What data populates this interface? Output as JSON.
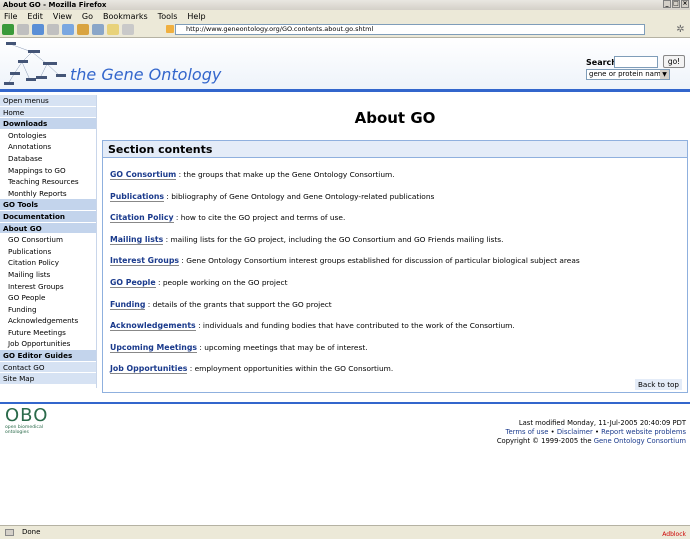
{
  "window": {
    "title": "About GO - Mozilla Firefox"
  },
  "menu": [
    "File",
    "Edit",
    "View",
    "Go",
    "Bookmarks",
    "Tools",
    "Help"
  ],
  "address": {
    "url": "http://www.geneontology.org/GO.contents.about.go.shtml"
  },
  "header": {
    "site_title": "the Gene Ontology",
    "search_label": "Search",
    "search_button": "go!",
    "search_scope": "gene or protein name"
  },
  "sidebar": [
    {
      "label": "Open menus",
      "kind": "top"
    },
    {
      "label": "Home",
      "kind": "top"
    },
    {
      "label": "Downloads",
      "kind": "bold"
    },
    {
      "label": "Ontologies",
      "kind": "sub"
    },
    {
      "label": "Annotations",
      "kind": "sub"
    },
    {
      "label": "Database",
      "kind": "sub"
    },
    {
      "label": "Mappings to GO",
      "kind": "sub"
    },
    {
      "label": "Teaching Resources",
      "kind": "sub"
    },
    {
      "label": "Monthly Reports",
      "kind": "sub"
    },
    {
      "label": "GO Tools",
      "kind": "bold"
    },
    {
      "label": "Documentation",
      "kind": "bold"
    },
    {
      "label": "About GO",
      "kind": "bold"
    },
    {
      "label": "GO Consortium",
      "kind": "sub"
    },
    {
      "label": "Publications",
      "kind": "sub"
    },
    {
      "label": "Citation Policy",
      "kind": "sub"
    },
    {
      "label": "Mailing lists",
      "kind": "sub"
    },
    {
      "label": "Interest Groups",
      "kind": "sub"
    },
    {
      "label": "GO People",
      "kind": "sub"
    },
    {
      "label": "Funding",
      "kind": "sub"
    },
    {
      "label": "Acknowledgements",
      "kind": "sub"
    },
    {
      "label": "Future Meetings",
      "kind": "sub"
    },
    {
      "label": "Job Opportunities",
      "kind": "sub"
    },
    {
      "label": "GO Editor Guides",
      "kind": "bold"
    },
    {
      "label": "Contact GO",
      "kind": "top"
    },
    {
      "label": "Site Map",
      "kind": "top"
    }
  ],
  "main": {
    "title": "About GO",
    "section_title": "Section contents",
    "back_to_top": "Back to top",
    "entries": [
      {
        "link": "GO Consortium",
        "text": ": the groups that make up the Gene Ontology Consortium."
      },
      {
        "link": "Publications",
        "text": ": bibliography of Gene Ontology and Gene Ontology-related publications"
      },
      {
        "link": "Citation Policy",
        "text": ": how to cite the GO project and terms of use."
      },
      {
        "link": "Mailing lists",
        "text": ": mailing lists for the GO project, including the GO Consortium and GO Friends mailing lists."
      },
      {
        "link": "Interest Groups",
        "text": ": Gene Ontology Consortium interest groups established for discussion of particular biological subject areas"
      },
      {
        "link": "GO People",
        "text": ": people working on the GO project"
      },
      {
        "link": "Funding",
        "text": ": details of the grants that support the GO project"
      },
      {
        "link": "Acknowledgements",
        "text": ": individuals and funding bodies that have contributed to the work of the Consortium."
      },
      {
        "link": "Upcoming Meetings",
        "text": ": upcoming meetings that may be of interest."
      },
      {
        "link": "Job Opportunities",
        "text": ": employment opportunities within the GO Consortium."
      }
    ]
  },
  "footer": {
    "obo_logo": "OBO",
    "obo_caption": "open biomedical ontologies",
    "last_modified": "Last modified Monday, 11-Jul-2005 20:40:09 PDT",
    "terms": "Terms of use",
    "sep": "•",
    "disclaimer": "Disclaimer",
    "report": "Report website problems",
    "copyright_prefix": "Copyright © 1999-2005 the",
    "consortium": "Gene Ontology Consortium"
  },
  "status": {
    "text": "Done",
    "adblock": "Adblock"
  },
  "colors": {
    "accent": "#3366cc",
    "link": "#1a3a8c",
    "nav_light": "#d6e2f3",
    "nav_bold": "#c3d4ec"
  }
}
